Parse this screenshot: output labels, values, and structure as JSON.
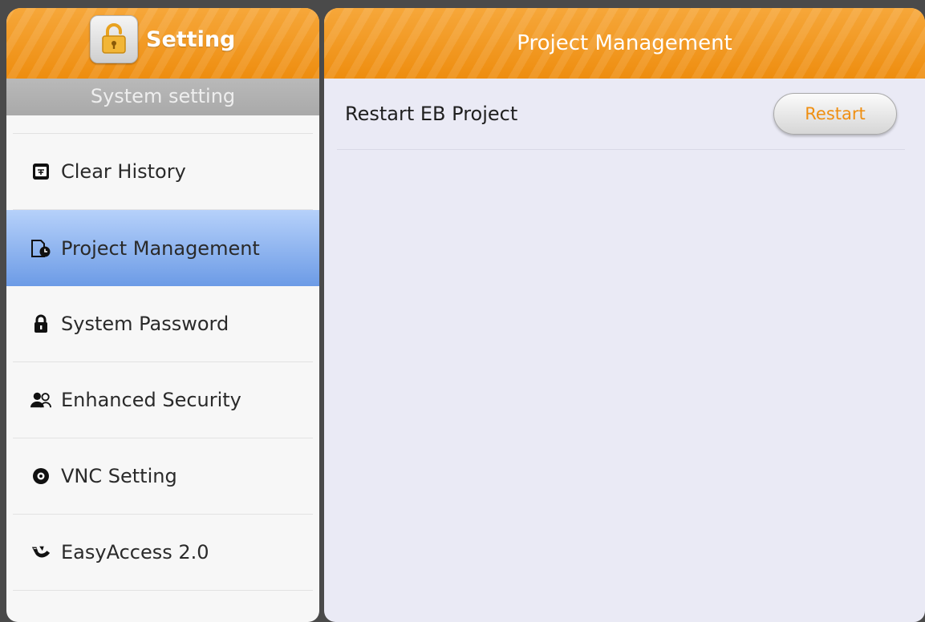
{
  "sidebar": {
    "title": "Setting",
    "section": "System setting",
    "items": [
      {
        "label": "Clear History",
        "icon": "clear-history-icon"
      },
      {
        "label": "Project Management",
        "icon": "project-management-icon",
        "selected": true
      },
      {
        "label": "System Password",
        "icon": "lock-icon"
      },
      {
        "label": "Enhanced Security",
        "icon": "users-security-icon"
      },
      {
        "label": "VNC Setting",
        "icon": "vnc-icon"
      },
      {
        "label": "EasyAccess 2.0",
        "icon": "easyaccess-icon"
      }
    ]
  },
  "main": {
    "title": "Project Management",
    "rows": [
      {
        "label": "Restart EB Project",
        "button": "Restart"
      }
    ]
  },
  "colors": {
    "header_orange": "#f39a1c",
    "selected_blue": "#6c9be6",
    "button_text": "#ef8f12",
    "frame": "#4a4a4a"
  }
}
